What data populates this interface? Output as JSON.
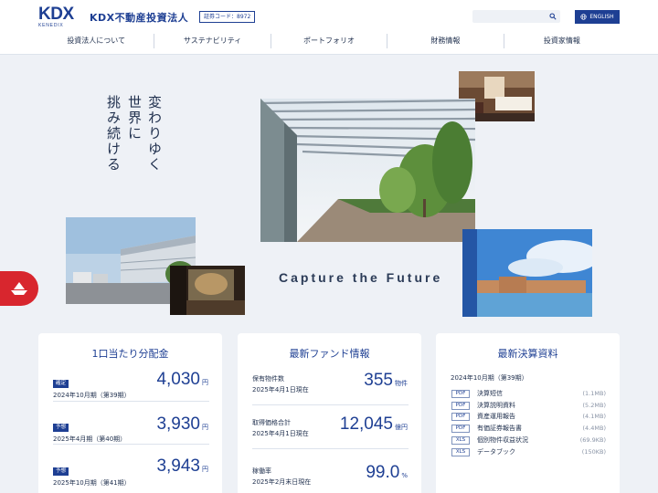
{
  "header": {
    "logo_text": "KDX",
    "logo_sub": "KENEDIX",
    "corp_name": "KDX不動産投資法人",
    "code_badge": "証券コード：8972",
    "search_placeholder": "",
    "lang_label": "ENGLISH"
  },
  "nav": [
    {
      "label": "投資法人について"
    },
    {
      "label": "サステナビリティ"
    },
    {
      "label": "ポートフォリオ"
    },
    {
      "label": "財務情報"
    },
    {
      "label": "投資家情報"
    }
  ],
  "hero": {
    "line1": "変わりゆく",
    "line2": "世界に",
    "line3": "挑み続ける",
    "tagline": "Capture the Future"
  },
  "dividend_card": {
    "title": "1口当たり分配金",
    "rows": [
      {
        "tag": "確定",
        "period": "2024年10月期（第39期）",
        "value": "4,030",
        "unit": "円"
      },
      {
        "tag": "予想",
        "period": "2025年4月期（第40期）",
        "value": "3,930",
        "unit": "円"
      },
      {
        "tag": "予想",
        "period": "2025年10月期（第41期）",
        "value": "3,943",
        "unit": "円"
      }
    ]
  },
  "fund_card": {
    "title": "最新ファンド情報",
    "rows": [
      {
        "label": "保有物件数",
        "date": "2025年4月1日現在",
        "value": "355",
        "unit": "物件"
      },
      {
        "label": "取得価格合計",
        "date": "2025年4月1日現在",
        "value": "12,045",
        "unit": "億円"
      },
      {
        "label": "稼働率",
        "date": "2025年2月末日現在",
        "value": "99.0",
        "unit": "%"
      }
    ]
  },
  "results_card": {
    "title": "最新決算資料",
    "period": "2024年10月期（第39期）",
    "docs": [
      {
        "type": "PDF",
        "name": "決算短信",
        "size": "(1.1MB)"
      },
      {
        "type": "PDF",
        "name": "決算説明資料",
        "size": "(5.2MB)"
      },
      {
        "type": "PDF",
        "name": "資産運用報告",
        "size": "(4.1MB)"
      },
      {
        "type": "PDF",
        "name": "有価証券報告書",
        "size": "(4.4MB)"
      },
      {
        "type": "XLS",
        "name": "個別物件収益状況",
        "size": "(69.9KB)"
      },
      {
        "type": "XLS",
        "name": "データブック",
        "size": "(150KB)"
      }
    ]
  },
  "colors": {
    "brand": "#1e3f93",
    "accent_red": "#d8262e",
    "background": "#eef1f6"
  }
}
